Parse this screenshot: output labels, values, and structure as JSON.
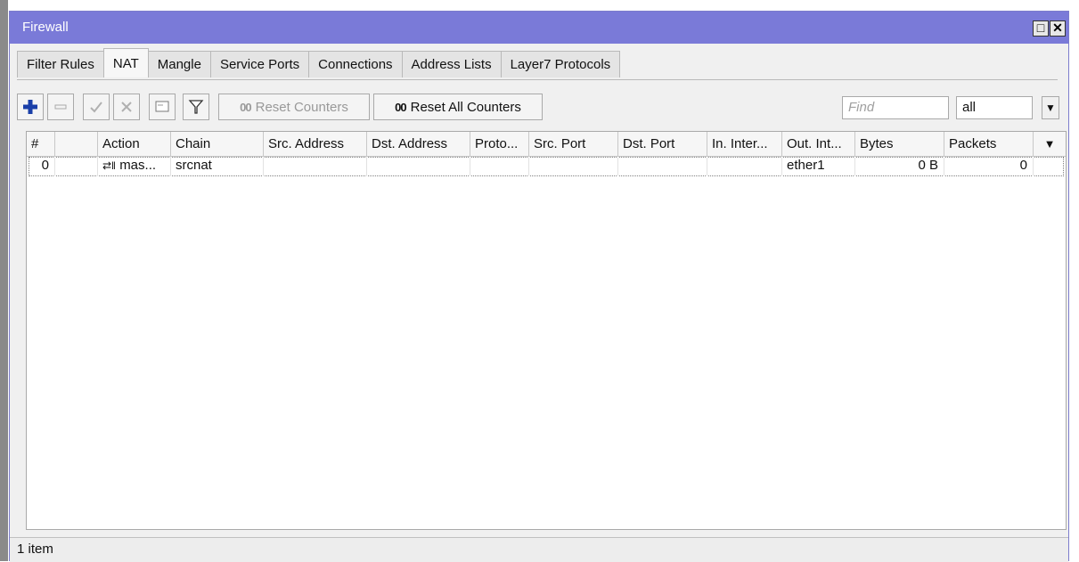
{
  "window": {
    "title": "Firewall",
    "restore_glyph": "□",
    "close_glyph": "✕"
  },
  "tabs": [
    {
      "label": "Filter Rules",
      "active": false
    },
    {
      "label": "NAT",
      "active": true
    },
    {
      "label": "Mangle",
      "active": false
    },
    {
      "label": "Service Ports",
      "active": false
    },
    {
      "label": "Connections",
      "active": false
    },
    {
      "label": "Address Lists",
      "active": false
    },
    {
      "label": "Layer7 Protocols",
      "active": false
    }
  ],
  "toolbar": {
    "reset_counters_prefix": "00",
    "reset_counters_label": "Reset Counters",
    "reset_all_counters_prefix": "00",
    "reset_all_counters_label": "Reset All Counters",
    "find_placeholder": "Find",
    "filter_selected": "all",
    "icons": {
      "add": "plus-icon",
      "remove": "minus-icon",
      "enable": "check-icon",
      "disable": "cross-icon",
      "comment": "comment-icon",
      "filter": "filter-icon"
    },
    "colors": {
      "add_icon": "#1a3fa8"
    }
  },
  "table": {
    "headers": [
      "#",
      "",
      "Action",
      "Chain",
      "Src. Address",
      "Dst. Address",
      "Proto...",
      "Src. Port",
      "Dst. Port",
      "In. Inter...",
      "Out. Int...",
      "Bytes",
      "Packets"
    ],
    "rows": [
      {
        "num": "0",
        "flag": "",
        "action_icon": "⇄‖",
        "action": "mas...",
        "chain": "srcnat",
        "src_address": "",
        "dst_address": "",
        "protocol": "",
        "src_port": "",
        "dst_port": "",
        "in_interface": "",
        "out_interface": "ether1",
        "bytes": "0 B",
        "packets": "0"
      }
    ]
  },
  "status": {
    "count": "1 item"
  }
}
